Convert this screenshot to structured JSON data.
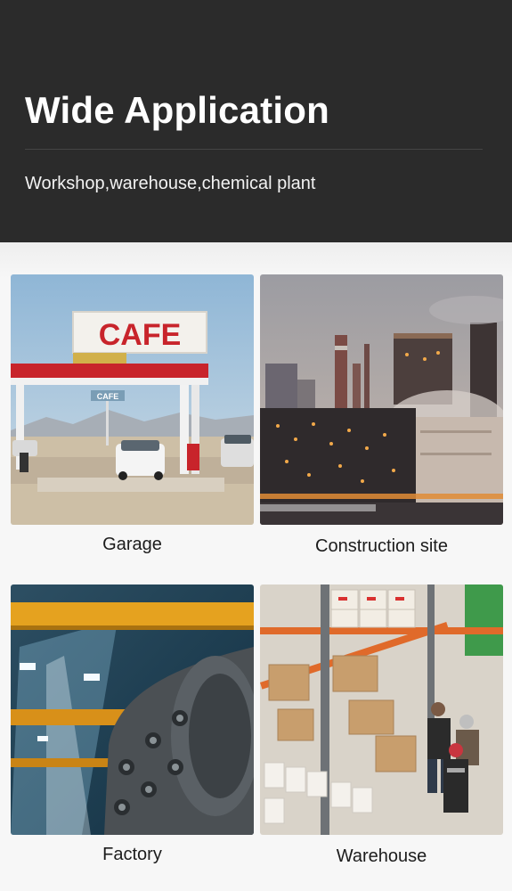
{
  "header": {
    "title": "Wide Application",
    "subtitle": "Workshop,warehouse,chemical plant"
  },
  "cards": [
    {
      "caption": "Garage",
      "sign_text": "CAFE",
      "small_sign_text": "CAFE",
      "icon": "garage-photo"
    },
    {
      "caption": "Construction site",
      "icon": "construction-site-photo"
    },
    {
      "caption": "Factory",
      "icon": "factory-photo"
    },
    {
      "caption": "Warehouse",
      "icon": "warehouse-photo"
    }
  ],
  "colors": {
    "header_bg": "#2b2b2b",
    "page_bg": "#f4f4f4",
    "cafe_red": "#c8242b"
  }
}
